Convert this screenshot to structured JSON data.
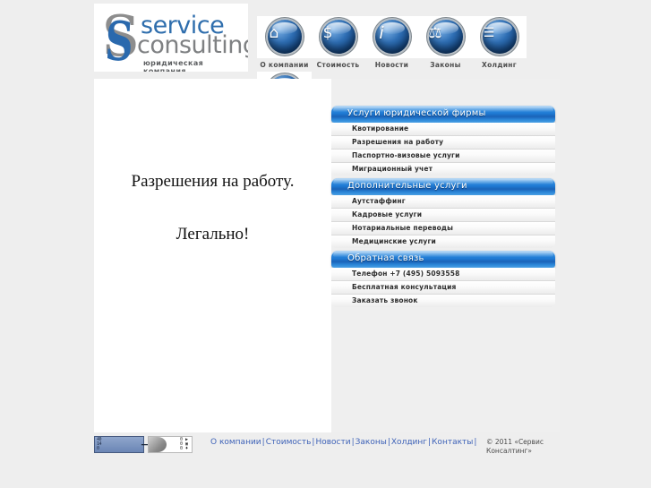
{
  "site": {
    "background_color": "#eeeeee",
    "accent_color": "#1f7ad3",
    "link_color": "#3f63b8"
  },
  "logo": {
    "mark_gray": "S",
    "mark_blue": "S",
    "word_top": "service",
    "word_bottom": "consulting",
    "tagline": "юридическая компания"
  },
  "topnav": {
    "items": [
      {
        "label": "О компании",
        "icon": "house-icon",
        "glyph": "⌂"
      },
      {
        "label": "Стоимость",
        "icon": "money-bag-icon",
        "glyph": "$"
      },
      {
        "label": "Новости",
        "icon": "info-icon",
        "glyph": "i"
      },
      {
        "label": "Законы",
        "icon": "judge-icon",
        "glyph": "⚖"
      },
      {
        "label": "Холдинг",
        "icon": "people-group-icon",
        "glyph": "☰"
      }
    ],
    "extra_item": {
      "label": "",
      "icon": "contacts-icon",
      "glyph": ""
    }
  },
  "main": {
    "headline": "Разрешения на работу.",
    "subline": "Легально!"
  },
  "sidebar": {
    "panels": [
      {
        "title": "Услуги юридической фирмы",
        "items": [
          "Квотирование",
          "Разрешения на работу",
          "Паспортно-визовые услуги",
          "Миграционный учет"
        ]
      },
      {
        "title": "Дополнительные услуги",
        "items": [
          "Аутстаффинг",
          "Кадровые услуги",
          "Нотариальные переводы",
          "Медицинские услуги"
        ]
      },
      {
        "title": "Обратная связь",
        "items": [
          "Телефон +7 (495) 5093558",
          "Бесплатная консультация",
          "Заказать звонок"
        ]
      }
    ]
  },
  "footer": {
    "counters": [
      {
        "name": "rambler-counter",
        "digits": "40\n14\n0"
      },
      {
        "name": "mail-counter",
        "digits": "0\n0\n0"
      }
    ],
    "links": [
      "О компании",
      "Стоимость",
      "Новости",
      "Законы",
      "Холдинг",
      "Контакты"
    ],
    "separator": "|",
    "copyright": "© 2011 «Сервис Консалтинг»"
  }
}
